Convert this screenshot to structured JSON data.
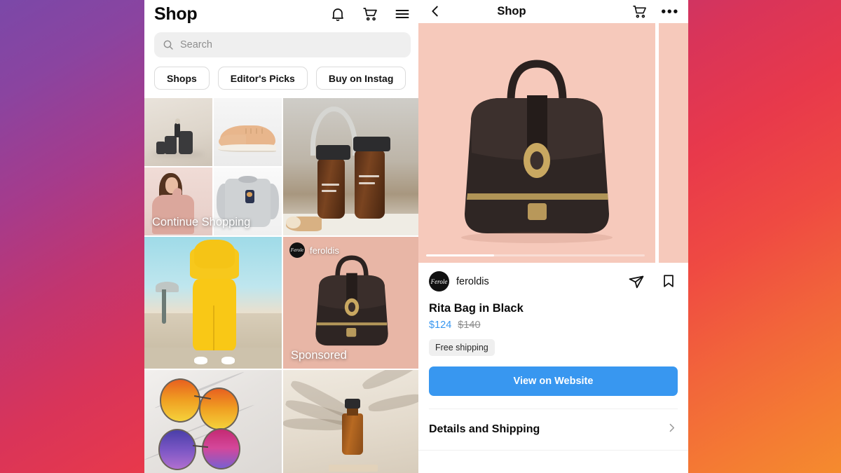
{
  "left_phone": {
    "header": {
      "title": "Shop",
      "icons": [
        "bell-icon",
        "cart-icon",
        "hamburger-menu-icon"
      ]
    },
    "search": {
      "placeholder": "Search",
      "icon": "search-icon"
    },
    "filter_chips": [
      "Shops",
      "Editor's Picks",
      "Buy on Instag"
    ],
    "tiles": [
      {
        "name": "continue-shopping-collage",
        "label": "Continue Shopping"
      },
      {
        "name": "spray-bottles-tile",
        "label": ""
      },
      {
        "name": "yellow-tracksuit-tile",
        "label": ""
      },
      {
        "name": "sponsored-bag-tile",
        "label": "Sponsored",
        "account": "feroldis"
      },
      {
        "name": "sunglasses-tile",
        "label": ""
      },
      {
        "name": "dropper-bottle-tile",
        "label": ""
      }
    ]
  },
  "right_phone": {
    "header": {
      "back_icon": "chevron-left-icon",
      "title": "Shop",
      "cart_icon": "cart-icon",
      "more_icon": "ellipsis-icon",
      "more_label": "•••"
    },
    "carousel": {
      "progress_percent": 31
    },
    "product": {
      "account": "feroldis",
      "avatar_mark": "Ferole",
      "share_icon": "share-paper-plane-icon",
      "save_icon": "bookmark-icon",
      "name": "Rita Bag in Black",
      "price": "$124",
      "original_price": "$140",
      "shipping_badge": "Free shipping",
      "cta_label": "View on Website",
      "details_row": "Details and Shipping",
      "details_chevron": "chevron-right-icon"
    }
  },
  "colors": {
    "accent_blue": "#3897f0",
    "hero_bg": "#f6c9bb",
    "chip_border": "#dbdbdb",
    "muted_text": "#8e8e8e"
  }
}
